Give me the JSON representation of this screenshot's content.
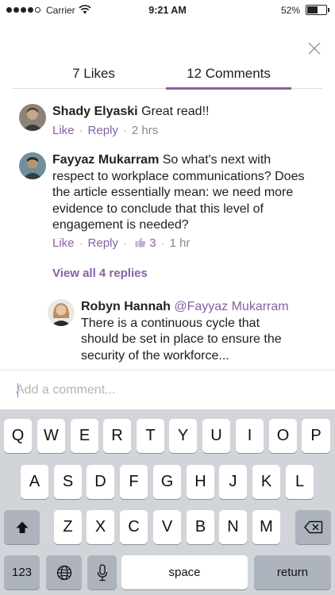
{
  "status": {
    "carrier": "Carrier",
    "time": "9:21 AM",
    "battery": "52%"
  },
  "tabs": {
    "likes": "7 Likes",
    "comments": "12 Comments"
  },
  "comments": [
    {
      "author": "Shady Elyaski",
      "text": "Great read!!",
      "like": "Like",
      "reply": "Reply",
      "time": "2 hrs"
    },
    {
      "author": "Fayyaz Mukarram",
      "text": "So what's next with respect to workplace communications? Does the article essentially mean: we need more evidence to conclude that this level of engagement is needed?",
      "like": "Like",
      "reply": "Reply",
      "likes_count": "3",
      "time": "1 hr"
    }
  ],
  "view_replies": "View all 4 replies",
  "reply": {
    "author": "Robyn Hannah",
    "mention": "@Fayyaz Mukarram",
    "text": "There is a continuous cycle that should be set in place to ensure the security of the workforce..."
  },
  "comment_input": {
    "placeholder": "Add a comment..."
  },
  "keyboard": {
    "row1": [
      "Q",
      "W",
      "E",
      "R",
      "T",
      "Y",
      "U",
      "I",
      "O",
      "P"
    ],
    "row2": [
      "A",
      "S",
      "D",
      "F",
      "G",
      "H",
      "J",
      "K",
      "L"
    ],
    "row3": [
      "Z",
      "X",
      "C",
      "V",
      "B",
      "N",
      "M"
    ],
    "numbers": "123",
    "space": "space",
    "return": "return"
  },
  "colors": {
    "accent": "#8a5fa3",
    "keyboard_bg": "#d1d4d9"
  },
  "icons": [
    "wifi-icon",
    "close-icon",
    "thumbs-up-icon",
    "globe-icon",
    "microphone-icon",
    "shift-icon",
    "backspace-icon"
  ]
}
